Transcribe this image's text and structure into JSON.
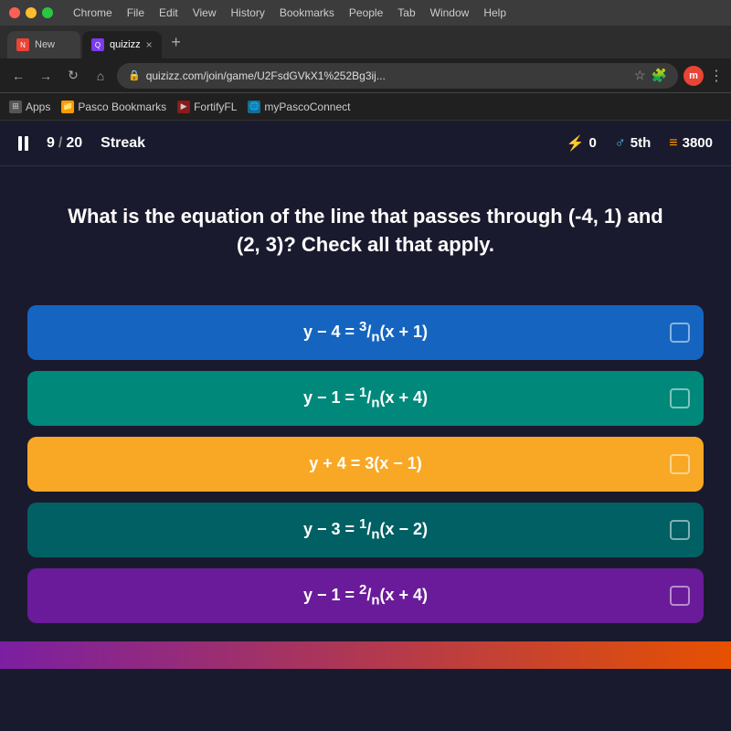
{
  "browser": {
    "title_bar": {
      "menu_items": [
        "Chrome",
        "File",
        "Edit",
        "View",
        "History",
        "Bookmarks",
        "People",
        "Tab",
        "Window",
        "Help"
      ]
    },
    "tabs": [
      {
        "label": "New",
        "active": false
      },
      {
        "label": "quizizz",
        "active": true
      },
      {
        "label": "",
        "active": false
      }
    ],
    "address": "quizizz.com/join/game/U2FsdGVkX1%252Bg3ij...",
    "new_tab_label": "+",
    "bookmarks": [
      {
        "label": "Apps",
        "icon": "🔲"
      },
      {
        "label": "Pasco Bookmarks",
        "icon": "📁"
      },
      {
        "label": "FortifyFL",
        "icon": "▶"
      },
      {
        "label": "myPascoConnect",
        "icon": "🌐"
      }
    ]
  },
  "game": {
    "pause_label": "❚❚",
    "question_current": "9",
    "question_total": "20",
    "streak_label": "Streak",
    "stat_lightning": "0",
    "stat_rank": "5th",
    "stat_coins": "3800",
    "question_text": "What is the equation of the line that passes through (-4, 1) and (2, 3)? Check all that apply.",
    "answers": [
      {
        "id": 1,
        "text": "y − 4 = ³⁄ₙ(x + 1)",
        "color": "blue"
      },
      {
        "id": 2,
        "text": "y − 1 = ¹⁄ₙ(x + 4)",
        "color": "teal"
      },
      {
        "id": 3,
        "text": "y + 4 = 3(x − 1)",
        "color": "yellow"
      },
      {
        "id": 4,
        "text": "y − 3 = ¹⁄ₙ(x − 2)",
        "color": "dark-teal"
      },
      {
        "id": 5,
        "text": "y − 1 = ²⁄ₙ(x + 4)",
        "color": "purple"
      }
    ]
  }
}
